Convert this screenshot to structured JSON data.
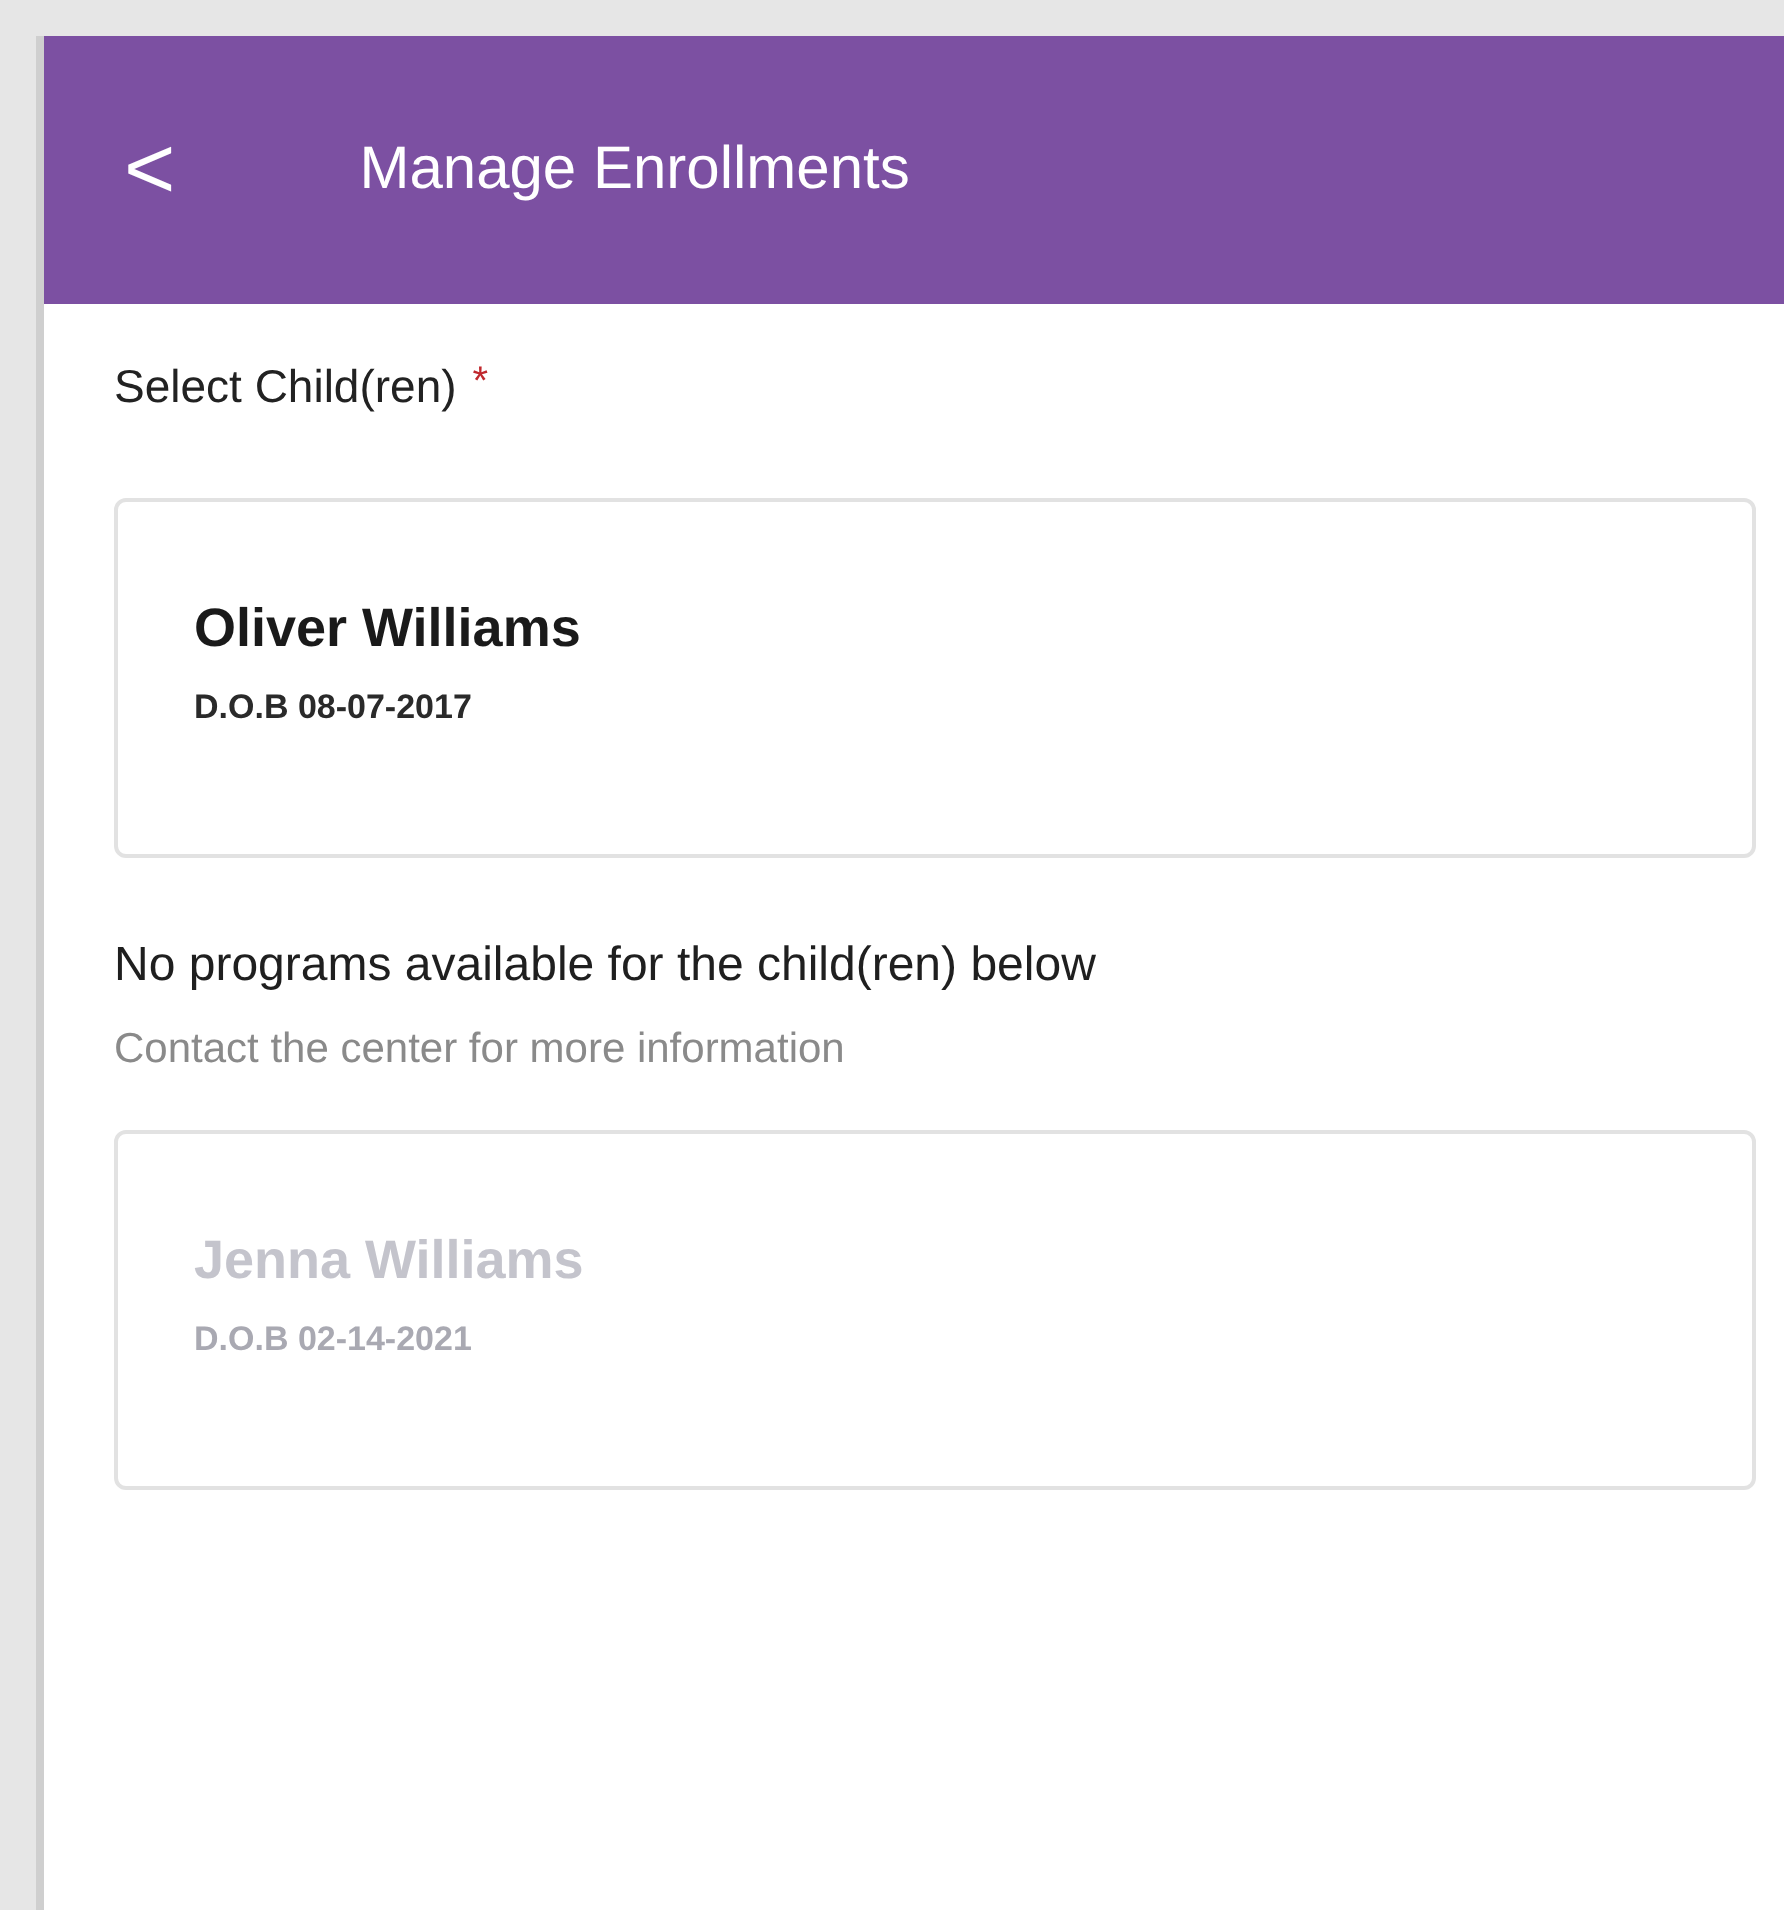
{
  "header": {
    "back_icon": "<",
    "title": "Manage Enrollments"
  },
  "select_label": {
    "text": "Select Child(ren)",
    "required_mark": "*"
  },
  "children": [
    {
      "name": "Oliver Williams",
      "dob": "D.O.B 08-07-2017",
      "disabled": false
    }
  ],
  "unavailable": {
    "heading": "No programs available for the child(ren) below",
    "note": "Contact the center for more information",
    "children": [
      {
        "name": "Jenna Williams",
        "dob": "D.O.B 02-14-2021",
        "disabled": true
      }
    ]
  }
}
